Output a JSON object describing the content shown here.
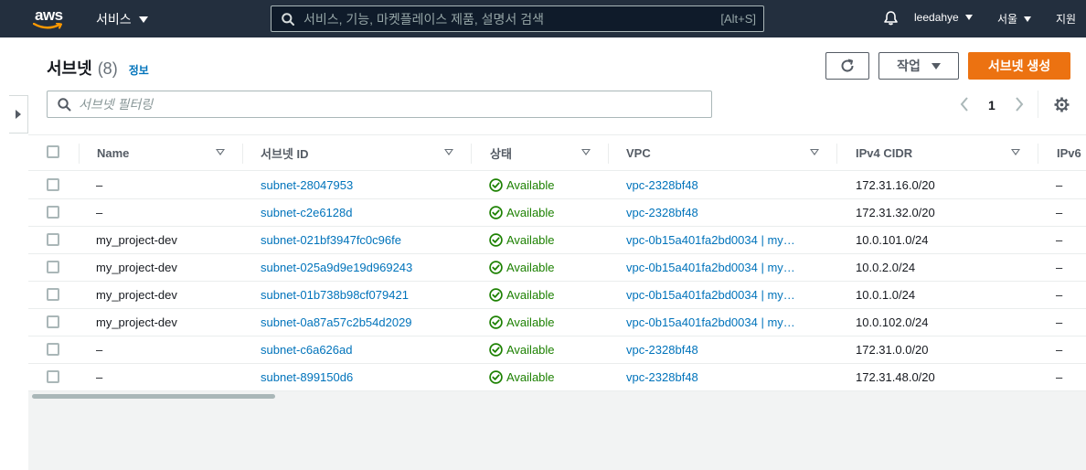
{
  "nav": {
    "logo_text": "aws",
    "services_label": "서비스",
    "search_placeholder": "서비스, 기능, 마켓플레이스 제품, 설명서 검색",
    "search_shortcut": "[Alt+S]",
    "user": "leedahye",
    "region": "서울",
    "support": "지원"
  },
  "page": {
    "title": "서브넷",
    "count": "(8)",
    "info_link": "정보",
    "actions_label": "작업",
    "create_label": "서브넷 생성",
    "filter_placeholder": "서브넷 필터링",
    "page_number": "1"
  },
  "table": {
    "columns": [
      "Name",
      "서브넷 ID",
      "상태",
      "VPC",
      "IPv4 CIDR",
      "IPv6"
    ],
    "rows": [
      {
        "name": "–",
        "subnet_id": "subnet-28047953",
        "status": "Available",
        "vpc": "vpc-2328bf48",
        "cidr": "172.31.16.0/20",
        "ipv6": "–"
      },
      {
        "name": "–",
        "subnet_id": "subnet-c2e6128d",
        "status": "Available",
        "vpc": "vpc-2328bf48",
        "cidr": "172.31.32.0/20",
        "ipv6": "–"
      },
      {
        "name": "my_project-dev",
        "subnet_id": "subnet-021bf3947fc0c96fe",
        "status": "Available",
        "vpc": "vpc-0b15a401fa2bd0034 | my…",
        "cidr": "10.0.101.0/24",
        "ipv6": "–"
      },
      {
        "name": "my_project-dev",
        "subnet_id": "subnet-025a9d9e19d969243",
        "status": "Available",
        "vpc": "vpc-0b15a401fa2bd0034 | my…",
        "cidr": "10.0.2.0/24",
        "ipv6": "–"
      },
      {
        "name": "my_project-dev",
        "subnet_id": "subnet-01b738b98cf079421",
        "status": "Available",
        "vpc": "vpc-0b15a401fa2bd0034 | my…",
        "cidr": "10.0.1.0/24",
        "ipv6": "–"
      },
      {
        "name": "my_project-dev",
        "subnet_id": "subnet-0a87a57c2b54d2029",
        "status": "Available",
        "vpc": "vpc-0b15a401fa2bd0034 | my…",
        "cidr": "10.0.102.0/24",
        "ipv6": "–"
      },
      {
        "name": "–",
        "subnet_id": "subnet-c6a626ad",
        "status": "Available",
        "vpc": "vpc-2328bf48",
        "cidr": "172.31.0.0/20",
        "ipv6": "–"
      },
      {
        "name": "–",
        "subnet_id": "subnet-899150d6",
        "status": "Available",
        "vpc": "vpc-2328bf48",
        "cidr": "172.31.48.0/20",
        "ipv6": "–"
      }
    ]
  },
  "colors": {
    "nav_bg": "#232f3e",
    "primary": "#ec7211",
    "link": "#0073bb",
    "available": "#1d8102"
  }
}
